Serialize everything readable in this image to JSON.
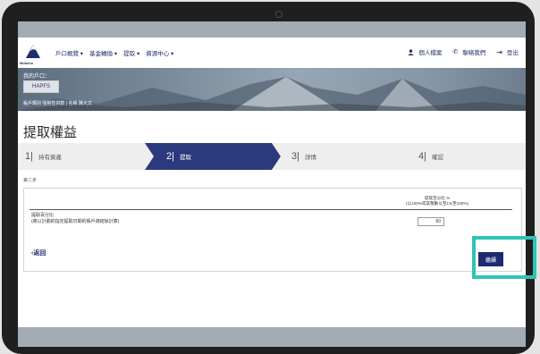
{
  "colors": {
    "brand": "#1f2f6b",
    "step_active": "#2b3a7c",
    "button": "#1c2a72",
    "highlight": "#2ec4b6"
  },
  "header": {
    "logo_text": "Mokeno",
    "menu": [
      "戶口概覽 ▾",
      "基金轉換 ▾",
      "提取 ▾",
      "資源中心 ▾"
    ],
    "profile_label": "個人檔案",
    "contact_label": "聯絡我們",
    "logout_label": "登出",
    "profile_icon": "user-icon",
    "contact_icon": "phone-icon",
    "logout_icon": "logout-icon"
  },
  "banner": {
    "account_label": "我的戶口：",
    "account_value": "HAPFS",
    "account_info": "帳戶類別 強制性供款 | 名稱 陳大文"
  },
  "page": {
    "title": "提取權益"
  },
  "steps": [
    {
      "num": "1|",
      "label": "持有資產",
      "active": false
    },
    {
      "num": "2|",
      "label": "提取",
      "active": true
    },
    {
      "num": "3|",
      "label": "詳情",
      "active": false
    },
    {
      "num": "4|",
      "label": "確認",
      "active": false
    }
  ],
  "step_caption": "第二步",
  "form": {
    "column_header_line1": "提取百分比 %",
    "column_header_line2": "(以100%或其整數以至1%至100%)",
    "row_label_line1": "提取百分比",
    "row_label_line2": "(將以計劃的指定提取日期的帳戶總結餘計算)",
    "percentage_value": "60",
    "back_label": "‹返回",
    "proceed_label": "繼續"
  }
}
